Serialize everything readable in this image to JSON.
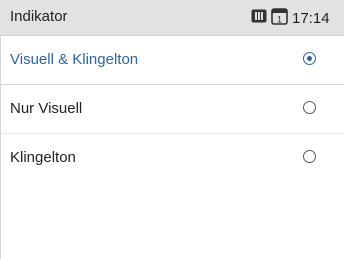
{
  "header": {
    "title": "Indikator",
    "time": "17:14",
    "icons": [
      "sim-card-icon",
      "calendar-icon"
    ],
    "calendar_day": "1"
  },
  "options": [
    {
      "label": "Visuell & Klingelton",
      "selected": true
    },
    {
      "label": "Nur Visuell",
      "selected": false
    },
    {
      "label": "Klingelton",
      "selected": false
    }
  ],
  "colors": {
    "accent": "#2e63a6",
    "statusbar_bg": "#e2e2e2",
    "text": "#222222"
  }
}
